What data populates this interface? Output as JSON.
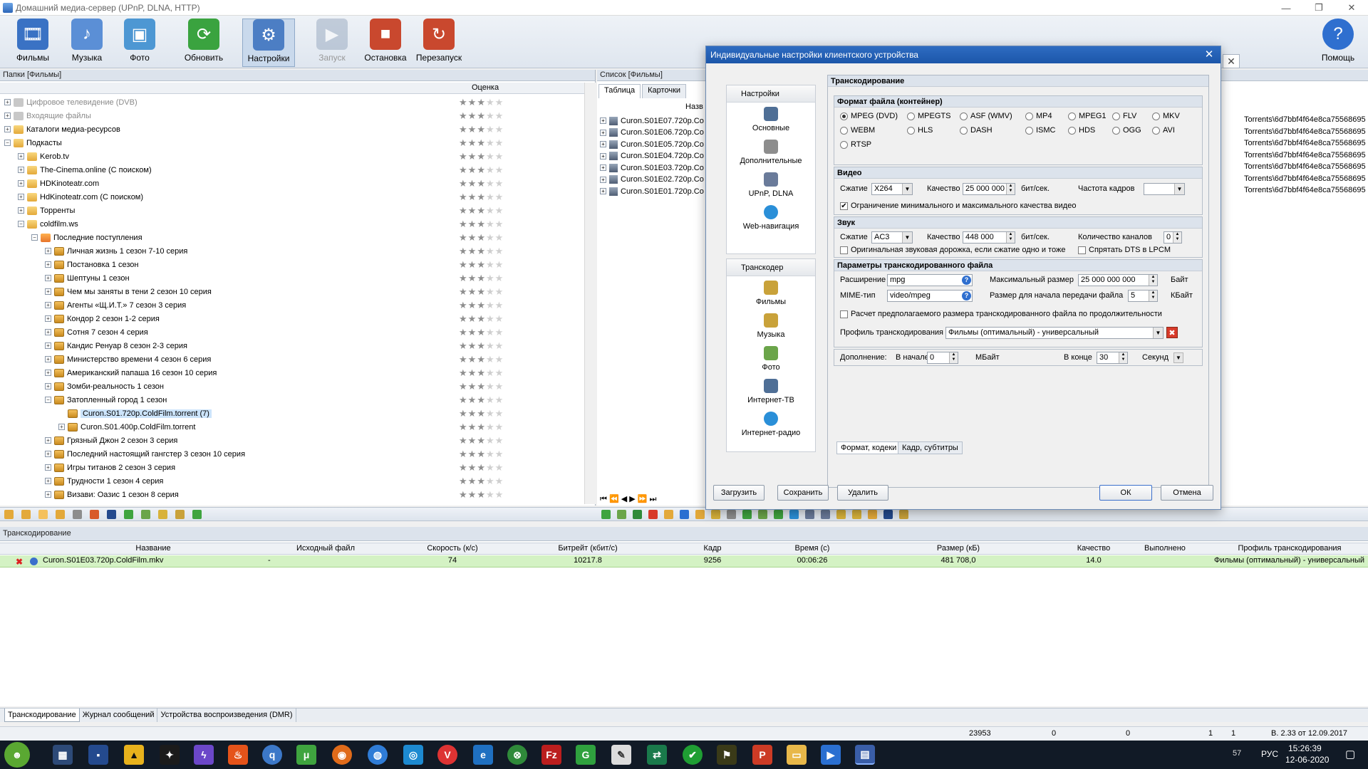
{
  "window": {
    "title": "Домашний медиа-сервер (UPnP, DLNA, HTTP)",
    "controls": [
      "—",
      "❐",
      "✕"
    ]
  },
  "toolbar": {
    "buttons": [
      {
        "label": "Фильмы",
        "icon": "films-icon",
        "color": "#3a72c4"
      },
      {
        "label": "Музыка",
        "icon": "music-icon",
        "color": "#5b8fd6"
      },
      {
        "label": "Фото",
        "icon": "photo-icon",
        "color": "#4d97d3"
      },
      {
        "label": "Обновить",
        "icon": "refresh-icon",
        "color": "#3aa33f"
      },
      {
        "label": "Настройки",
        "icon": "settings-icon",
        "color": "#4c7ec4"
      },
      {
        "label": "Запуск",
        "icon": "start-icon",
        "color": "#8c9fb8"
      },
      {
        "label": "Остановка",
        "icon": "stop-icon",
        "color": "#c9482e"
      },
      {
        "label": "Перезапуск",
        "icon": "restart-icon",
        "color": "#c9482e"
      }
    ],
    "help_label": "Помощь"
  },
  "left_panel": {
    "header": "Папки [Фильмы]",
    "rating_header": "Оценка",
    "rows": [
      {
        "label": "Цифровое телевидение (DVB)",
        "level": 0,
        "icon": "gray",
        "gray": true,
        "stars": 3
      },
      {
        "label": "Входящие файлы",
        "level": 0,
        "icon": "gray",
        "gray": true,
        "stars": 3
      },
      {
        "label": "Каталоги медиа-ресурсов",
        "level": 0,
        "icon": "folder",
        "stars": 3
      },
      {
        "label": "Подкасты",
        "level": 0,
        "icon": "folder",
        "expanded": true,
        "stars": 3
      },
      {
        "label": "Kerob.tv",
        "level": 1,
        "icon": "folder",
        "stars": 3
      },
      {
        "label": "The-Cinema.online (С поиском)",
        "level": 1,
        "icon": "folder",
        "stars": 3
      },
      {
        "label": "HDKinoteatr.com",
        "level": 1,
        "icon": "folder",
        "stars": 3
      },
      {
        "label": "HdKinoteatr.com (С поиском)",
        "level": 1,
        "icon": "folder",
        "stars": 3
      },
      {
        "label": "Торренты",
        "level": 1,
        "icon": "folder",
        "stars": 3
      },
      {
        "label": "coldfilm.ws",
        "level": 1,
        "icon": "folder",
        "expanded": true,
        "stars": 3
      },
      {
        "label": "Последние поступления",
        "level": 2,
        "icon": "rss",
        "expanded": true,
        "stars": 3
      },
      {
        "label": "Личная жизнь 1 сезон 7-10 серия",
        "level": 3,
        "icon": "pkg",
        "stars": 3
      },
      {
        "label": "Постановка 1 сезон",
        "level": 3,
        "icon": "pkg",
        "stars": 3
      },
      {
        "label": "Шептуны 1 сезон",
        "level": 3,
        "icon": "pkg",
        "stars": 3
      },
      {
        "label": "Чем мы заняты в тени 2 сезон 10 серия",
        "level": 3,
        "icon": "pkg",
        "stars": 3
      },
      {
        "label": "Агенты «Щ.И.Т.» 7 сезон 3 серия",
        "level": 3,
        "icon": "pkg",
        "stars": 3
      },
      {
        "label": "Кондор 2 сезон 1-2 серия",
        "level": 3,
        "icon": "pkg",
        "stars": 3
      },
      {
        "label": "Сотня 7 сезон 4 серия",
        "level": 3,
        "icon": "pkg",
        "stars": 3
      },
      {
        "label": "Кандис Ренуар 8 сезон 2-3 серия",
        "level": 3,
        "icon": "pkg",
        "stars": 3
      },
      {
        "label": "Министерство времени 4 сезон 6 серия",
        "level": 3,
        "icon": "pkg",
        "stars": 3
      },
      {
        "label": "Американский папаша 16 сезон 10 серия",
        "level": 3,
        "icon": "pkg",
        "stars": 3
      },
      {
        "label": "Зомби-реальность 1 сезон",
        "level": 3,
        "icon": "pkg",
        "stars": 3
      },
      {
        "label": "Затопленный город 1 сезон",
        "level": 3,
        "icon": "pkg",
        "expanded": true,
        "stars": 3
      },
      {
        "label": "Curon.S01.720p.ColdFilm.torrent (7)",
        "level": 4,
        "icon": "pkg",
        "selected": true,
        "noexp": true,
        "stars": 3
      },
      {
        "label": "Curon.S01.400p.ColdFilm.torrent",
        "level": 4,
        "icon": "pkg",
        "stars": 3
      },
      {
        "label": "Грязный Джон 2 сезон 3 серия",
        "level": 3,
        "icon": "pkg",
        "stars": 3
      },
      {
        "label": "Последний настоящий гангстер 3 сезон 10 серия",
        "level": 3,
        "icon": "pkg",
        "stars": 3
      },
      {
        "label": "Игры титанов 2 сезон 3 серия",
        "level": 3,
        "icon": "pkg",
        "stars": 3
      },
      {
        "label": "Трудности 1 сезон 4 серия",
        "level": 3,
        "icon": "pkg",
        "stars": 3
      },
      {
        "label": "Визави: Оазис 1 сезон 8 серия",
        "level": 3,
        "icon": "pkg",
        "stars": 3
      }
    ]
  },
  "right_panel": {
    "header": "Список [Фильмы]",
    "tabs": [
      "Таблица",
      "Карточки"
    ],
    "col_name": "Назв",
    "items": [
      "Curon.S01E07.720p.Co",
      "Curon.S01E06.720p.Co",
      "Curon.S01E05.720p.Co",
      "Curon.S01E04.720p.Co",
      "Curon.S01E03.720p.Co",
      "Curon.S01E02.720p.Co",
      "Curon.S01E01.720p.Co"
    ],
    "paths": [
      "Torrents\\6d7bbf4f64e8ca75568695",
      "Torrents\\6d7bbf4f64e8ca75568695",
      "Torrents\\6d7bbf4f64e8ca75568695",
      "Torrents\\6d7bbf4f64e8ca75568695",
      "Torrents\\6d7bbf4f64e8ca75568695",
      "Torrents\\6d7bbf4f64e8ca75568695",
      "Torrents\\6d7bbf4f64e8ca75568695"
    ],
    "nav": "⏮ ⏪ ◀ ▶ ⏩ ⏭"
  },
  "transcoding_panel": {
    "header": "Транскодирование",
    "columns": [
      "Название",
      "Исходный файл",
      "Скорость (к/с)",
      "Битрейт (кбит/с)",
      "Кадр",
      "Время (с)",
      "Размер (кБ)",
      "Качество",
      "Выполнено",
      "Профиль транскодирования"
    ],
    "row": {
      "name": "Curon.S01E03.720p.ColdFilm.mkv",
      "source": "-",
      "speed": "74",
      "bitrate": "10217.8",
      "frame": "9256",
      "time": "00:06:26",
      "size": "481 708,0",
      "quality": "14.0",
      "done": "",
      "profile": "Фильмы (оптимальный) - универсальный"
    }
  },
  "bottom_tabs": [
    "Транскодирование",
    "Журнал сообщений",
    "Устройства воспроизведения (DMR)"
  ],
  "status_bar": {
    "count": "23953",
    "v1": "0",
    "v2": "0",
    "v3": "1",
    "v4": "1",
    "version": "В. 2.33 от 12.09.2017"
  },
  "taskbar": {
    "lang": "РУС",
    "time": "15:26:39",
    "date": "12-06-2020",
    "badge": "57"
  },
  "dialog": {
    "title": "Индивидуальные настройки клиентского устройства",
    "nav_group1": "Настройки",
    "nav_items1": [
      "Основные",
      "Дополнительные",
      "UPnP, DLNA",
      "Web-навигация"
    ],
    "nav_group2": "Транскодер",
    "nav_items2": [
      "Фильмы",
      "Музыка",
      "Фото",
      "Интернет-ТВ",
      "Интернет-радио"
    ],
    "content_title": "Транскодирование",
    "format_section": "Формат файла (контейнер)",
    "formats": [
      "MPEG (DVD)",
      "MPEGTS",
      "ASF (WMV)",
      "MP4",
      "MPEG1",
      "FLV",
      "MKV",
      "WEBM",
      "HLS",
      "DASH",
      "ISMC",
      "HDS",
      "OGG",
      "AVI",
      "RTSP"
    ],
    "selected_format": "MPEG (DVD)",
    "video_section": "Видео",
    "video_codec_label": "Сжатие",
    "video_codec": "X264",
    "video_quality_label": "Качество",
    "video_quality": "25 000 000",
    "video_unit": "бит/сек.",
    "framerate_label": "Частота кадров",
    "framerate": "",
    "video_limit_chk": "Ограничение минимального и максимального качества видео",
    "audio_section": "Звук",
    "audio_codec_label": "Сжатие",
    "audio_codec": "AC3",
    "audio_quality_label": "Качество",
    "audio_quality": "448 000",
    "audio_unit": "бит/сек.",
    "channels_label": "Количество каналов",
    "channels": "0",
    "orig_audio_chk": "Оригинальная звуковая дорожка, если сжатие одно и тоже",
    "hide_dts_chk": "Спрятать DTS в LPCM",
    "params_section": "Параметры транскодированного файла",
    "ext_label": "Расширение",
    "ext": "mpg",
    "mime_label": "MIME-тип",
    "mime": "video/mpeg",
    "maxsize_label": "Максимальный размер",
    "maxsize": "25 000 000 000",
    "maxsize_unit": "Байт",
    "startsize_label": "Размер для начала передачи файла",
    "startsize": "5",
    "startsize_unit": "КБайт",
    "calc_chk": "Расчет предполагаемого размера транскодированного файла по продолжительности",
    "profile_label": "Профиль транскодирования",
    "profile": "Фильмы (оптимальный) - универсальный",
    "extra_label": "Дополнение:",
    "begin_label": "В начале",
    "begin": "0",
    "begin_unit": "МБайт",
    "end_label": "В конце",
    "end": "30",
    "end_unit": "Секунд",
    "tabs": [
      "Формат, кодеки",
      "Кадр, субтитры"
    ],
    "buttons": {
      "load": "Загрузить",
      "save": "Сохранить",
      "delete": "Удалить",
      "ok": "ОК",
      "cancel": "Отмена"
    }
  }
}
